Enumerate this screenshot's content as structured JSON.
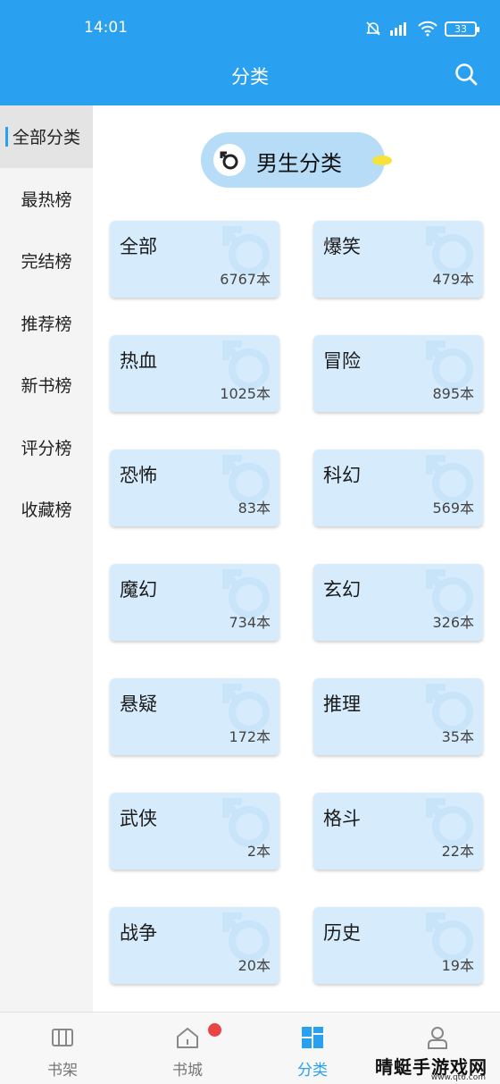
{
  "status": {
    "time": "14:01",
    "battery": "33"
  },
  "header": {
    "title": "分类"
  },
  "sidebar": {
    "items": [
      {
        "label": "全部分类"
      },
      {
        "label": "最热榜"
      },
      {
        "label": "完结榜"
      },
      {
        "label": "推荐榜"
      },
      {
        "label": "新书榜"
      },
      {
        "label": "评分榜"
      },
      {
        "label": "收藏榜"
      }
    ]
  },
  "gender": {
    "label": "男生分类"
  },
  "categories": [
    {
      "name": "全部",
      "count": "6767本"
    },
    {
      "name": "爆笑",
      "count": "479本"
    },
    {
      "name": "热血",
      "count": "1025本"
    },
    {
      "name": "冒险",
      "count": "895本"
    },
    {
      "name": "恐怖",
      "count": "83本"
    },
    {
      "name": "科幻",
      "count": "569本"
    },
    {
      "name": "魔幻",
      "count": "734本"
    },
    {
      "name": "玄幻",
      "count": "326本"
    },
    {
      "name": "悬疑",
      "count": "172本"
    },
    {
      "name": "推理",
      "count": "35本"
    },
    {
      "name": "武侠",
      "count": "2本"
    },
    {
      "name": "格斗",
      "count": "22本"
    },
    {
      "name": "战争",
      "count": "20本"
    },
    {
      "name": "历史",
      "count": "19本"
    }
  ],
  "bottom_nav": {
    "items": [
      {
        "label": "书架"
      },
      {
        "label": "书城"
      },
      {
        "label": "分类"
      },
      {
        "label": ""
      }
    ]
  },
  "watermark": {
    "text": "晴蜓手游戏网",
    "url": "www.qt6.com"
  },
  "colors": {
    "accent": "#29a0f0",
    "card": "#d6ebfb",
    "pill": "#b6dcf8",
    "badge": "#e94545"
  }
}
